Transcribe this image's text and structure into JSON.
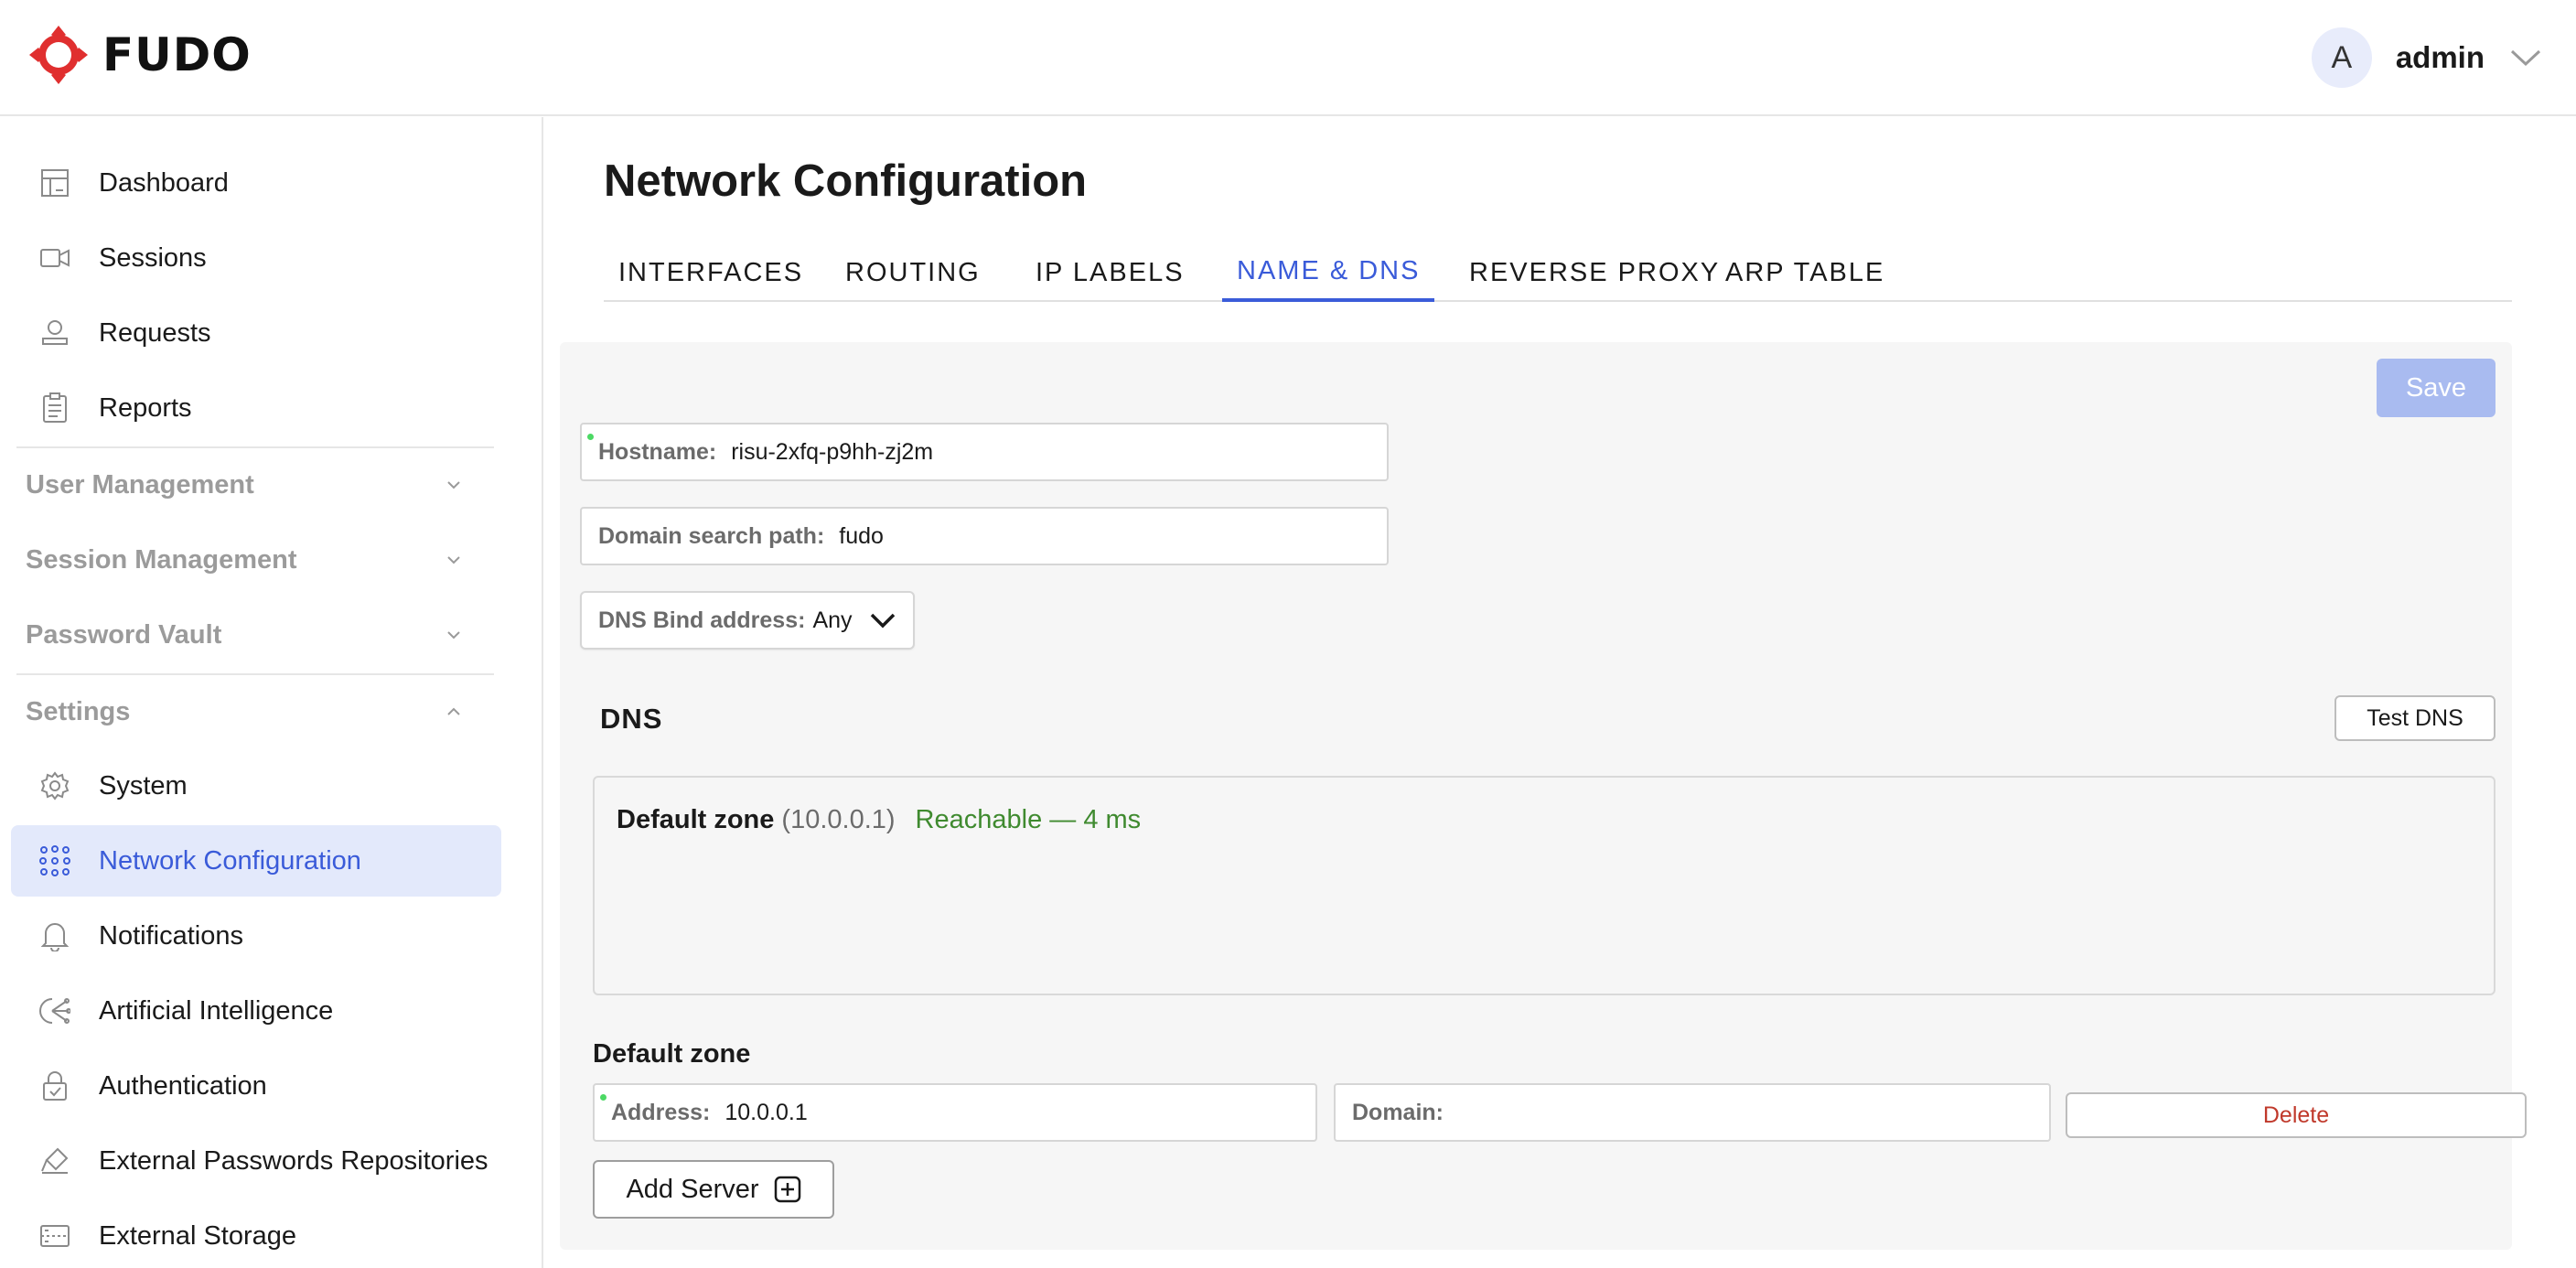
{
  "app": {
    "brand": "FUDO",
    "brand_color": "#e02f2f"
  },
  "user": {
    "avatar_initial": "A",
    "name": "admin"
  },
  "sidebar": {
    "items_top": [
      {
        "label": "Dashboard",
        "icon": "dashboard-icon"
      },
      {
        "label": "Sessions",
        "icon": "video-camera-icon"
      },
      {
        "label": "Requests",
        "icon": "requests-icon"
      },
      {
        "label": "Reports",
        "icon": "clipboard-icon"
      }
    ],
    "sections": [
      {
        "label": "User Management",
        "expanded": false
      },
      {
        "label": "Session Management",
        "expanded": false
      },
      {
        "label": "Password Vault",
        "expanded": false
      },
      {
        "label": "Settings",
        "expanded": true
      }
    ],
    "settings_items": [
      {
        "label": "System",
        "icon": "gear-icon"
      },
      {
        "label": "Network Configuration",
        "icon": "network-icon",
        "active": true
      },
      {
        "label": "Notifications",
        "icon": "bell-icon"
      },
      {
        "label": "Artificial Intelligence",
        "icon": "ai-icon"
      },
      {
        "label": "Authentication",
        "icon": "lock-icon"
      },
      {
        "label": "External Passwords Repositories",
        "icon": "key-icon"
      },
      {
        "label": "External Storage",
        "icon": "storage-icon"
      }
    ]
  },
  "main": {
    "title": "Network Configuration",
    "tabs": [
      {
        "label": "INTERFACES"
      },
      {
        "label": "ROUTING"
      },
      {
        "label": "IP LABELS"
      },
      {
        "label": "NAME & DNS",
        "active": true
      },
      {
        "label": "REVERSE PROXY"
      },
      {
        "label": "ARP TABLE"
      }
    ],
    "save_label": "Save",
    "hostname": {
      "label": "Hostname:",
      "value": "risu-2xfq-p9hh-zj2m"
    },
    "domain_search": {
      "label": "Domain search path:",
      "value": "fudo"
    },
    "dns_bind": {
      "label": "DNS Bind address:",
      "value": "Any"
    },
    "dns": {
      "title": "DNS",
      "test_label": "Test DNS",
      "zone_name": "Default zone",
      "zone_ip": "(10.0.0.1)",
      "zone_status": "Reachable — 4 ms"
    },
    "default_zone": {
      "title": "Default zone",
      "address_label": "Address:",
      "address_value": "10.0.0.1",
      "domain_label": "Domain:",
      "domain_value": "",
      "delete_label": "Delete",
      "add_server_label": "Add Server"
    }
  },
  "colors": {
    "accent": "#3a5bd9",
    "active_bg": "#e3e9fb",
    "success": "#3f8a2f",
    "danger": "#c0392b",
    "save_disabled": "#a9bbf0"
  }
}
